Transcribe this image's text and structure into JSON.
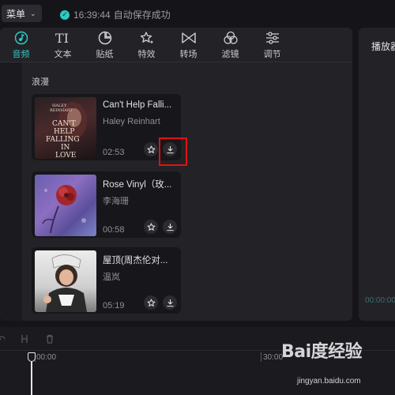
{
  "topbar": {
    "menu_label": "菜单",
    "save_time": "16:39:44",
    "save_text": "自动保存成功"
  },
  "tabs": [
    {
      "label": "音频",
      "icon": "music-note-icon",
      "active": true
    },
    {
      "label": "文本",
      "icon": "text-icon",
      "active": false
    },
    {
      "label": "贴纸",
      "icon": "sticker-icon",
      "active": false
    },
    {
      "label": "特效",
      "icon": "sparkle-star-icon",
      "active": false
    },
    {
      "label": "转场",
      "icon": "transition-bowtie-icon",
      "active": false
    },
    {
      "label": "滤镜",
      "icon": "filter-circles-icon",
      "active": false
    },
    {
      "label": "调节",
      "icon": "adjust-sliders-icon",
      "active": false
    }
  ],
  "category": "浪漫",
  "songs": [
    {
      "title": "Can't Help Falli...",
      "artist": "Haley Reinhart",
      "duration": "02:53",
      "cover_art": {
        "line1": "HALEY",
        "line2": "REINHART",
        "lines": [
          "CAN'T",
          "HELP",
          "FALLING",
          "IN",
          "LOVE"
        ]
      }
    },
    {
      "title": "Rose Vinyl（玫...",
      "artist": "李海珊",
      "duration": "00:58"
    },
    {
      "title": "屋顶(周杰伦对...",
      "artist": "温岚",
      "duration": "05:19"
    }
  ],
  "preview": {
    "title": "播放器",
    "timecode": "00:00:00"
  },
  "timeline": {
    "start_label": "00:00",
    "mark_label": "30:00"
  },
  "watermark": {
    "logo": "Bai度经验",
    "url": "jingyan.baidu.com"
  },
  "colors": {
    "accent": "#2bc9c5",
    "highlight": "#e01212",
    "background": "#151519",
    "panel": "#222227"
  }
}
